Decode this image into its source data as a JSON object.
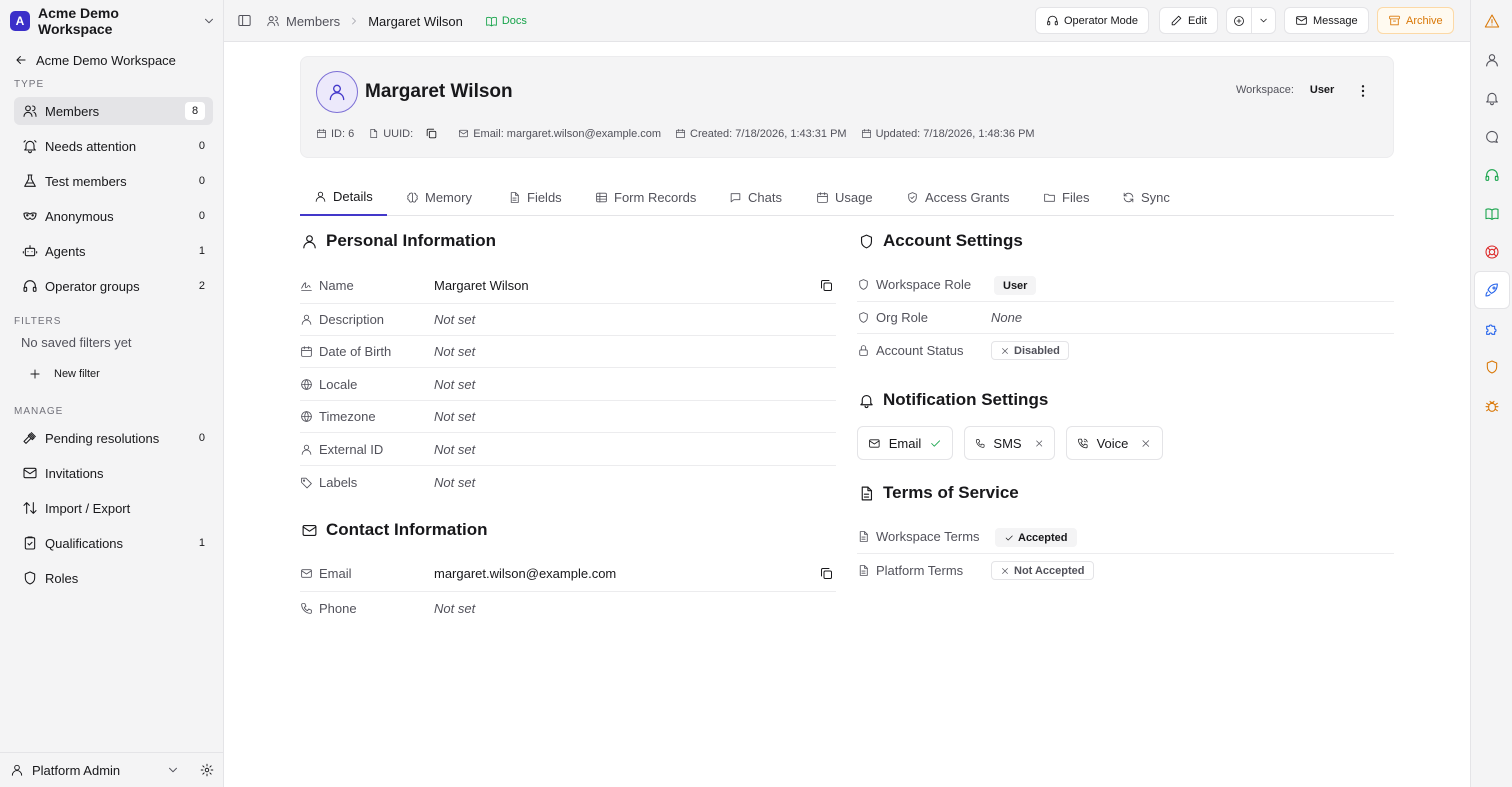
{
  "sidebar": {
    "workspace_initial": "A",
    "workspace_name": "Acme Demo Workspace",
    "back_label": "Acme Demo Workspace",
    "type_label": "TYPE",
    "type_items": [
      {
        "label": "Members",
        "count": "8",
        "icon": "users-icon"
      },
      {
        "label": "Needs attention",
        "count": "0",
        "icon": "bell-ring-icon"
      },
      {
        "label": "Test members",
        "count": "0",
        "icon": "flask-icon"
      },
      {
        "label": "Anonymous",
        "count": "0",
        "icon": "mask-icon"
      },
      {
        "label": "Agents",
        "count": "1",
        "icon": "robot-icon"
      },
      {
        "label": "Operator groups",
        "count": "2",
        "icon": "headset-icon"
      }
    ],
    "filters_label": "FILTERS",
    "no_filters": "No saved filters yet",
    "new_filter": "New filter",
    "manage_label": "MANAGE",
    "manage_items": [
      {
        "label": "Pending resolutions",
        "count": "0",
        "icon": "gavel-icon"
      },
      {
        "label": "Invitations",
        "count": "",
        "icon": "mail-icon"
      },
      {
        "label": "Import / Export",
        "count": "",
        "icon": "arrows-icon"
      },
      {
        "label": "Qualifications",
        "count": "1",
        "icon": "clipboard-icon"
      },
      {
        "label": "Roles",
        "count": "",
        "icon": "shield-icon"
      }
    ],
    "user_name": "Platform Admin"
  },
  "topbar": {
    "crumb_members": "Members",
    "crumb_current": "Margaret Wilson",
    "docs": "Docs",
    "operator_mode": "Operator Mode",
    "edit": "Edit",
    "message": "Message",
    "archive": "Archive"
  },
  "profile": {
    "name": "Margaret Wilson",
    "workspace_label": "Workspace:",
    "workspace_value": "User",
    "id": "ID: 6",
    "uuid": "UUID:",
    "email": "Email: margaret.wilson@example.com",
    "created": "Created: 7/18/2026, 1:43:31 PM",
    "updated": "Updated: 7/18/2026, 1:48:36 PM"
  },
  "tabs": [
    "Details",
    "Memory",
    "Fields",
    "Form Records",
    "Chats",
    "Usage",
    "Access Grants",
    "Files",
    "Sync"
  ],
  "personal": {
    "title": "Personal Information",
    "rows": [
      {
        "label": "Name",
        "value": "Margaret Wilson"
      },
      {
        "label": "Description",
        "value": "Not set"
      },
      {
        "label": "Date of Birth",
        "value": "Not set"
      },
      {
        "label": "Locale",
        "value": "Not set"
      },
      {
        "label": "Timezone",
        "value": "Not set"
      },
      {
        "label": "External ID",
        "value": "Not set"
      },
      {
        "label": "Labels",
        "value": "Not set"
      }
    ]
  },
  "contact": {
    "title": "Contact Information",
    "rows": [
      {
        "label": "Email",
        "value": "margaret.wilson@example.com"
      },
      {
        "label": "Phone",
        "value": "Not set"
      }
    ]
  },
  "account": {
    "title": "Account Settings",
    "workspace_role_label": "Workspace Role",
    "workspace_role_value": "User",
    "org_role_label": "Org Role",
    "org_role_value": "None",
    "status_label": "Account Status",
    "status_value": "Disabled"
  },
  "notifications": {
    "title": "Notification Settings",
    "email": "Email",
    "sms": "SMS",
    "voice": "Voice"
  },
  "terms": {
    "title": "Terms of Service",
    "workspace_label": "Workspace Terms",
    "workspace_value": "Accepted",
    "platform_label": "Platform Terms",
    "platform_value": "Not Accepted"
  },
  "colors": {
    "accent": "#4338ca",
    "success": "#16a34a",
    "warning": "#d97706",
    "rail_green": "#16a34a",
    "rail_red": "#dc2626",
    "rail_blue": "#2563eb",
    "rail_orange": "#d97706"
  }
}
